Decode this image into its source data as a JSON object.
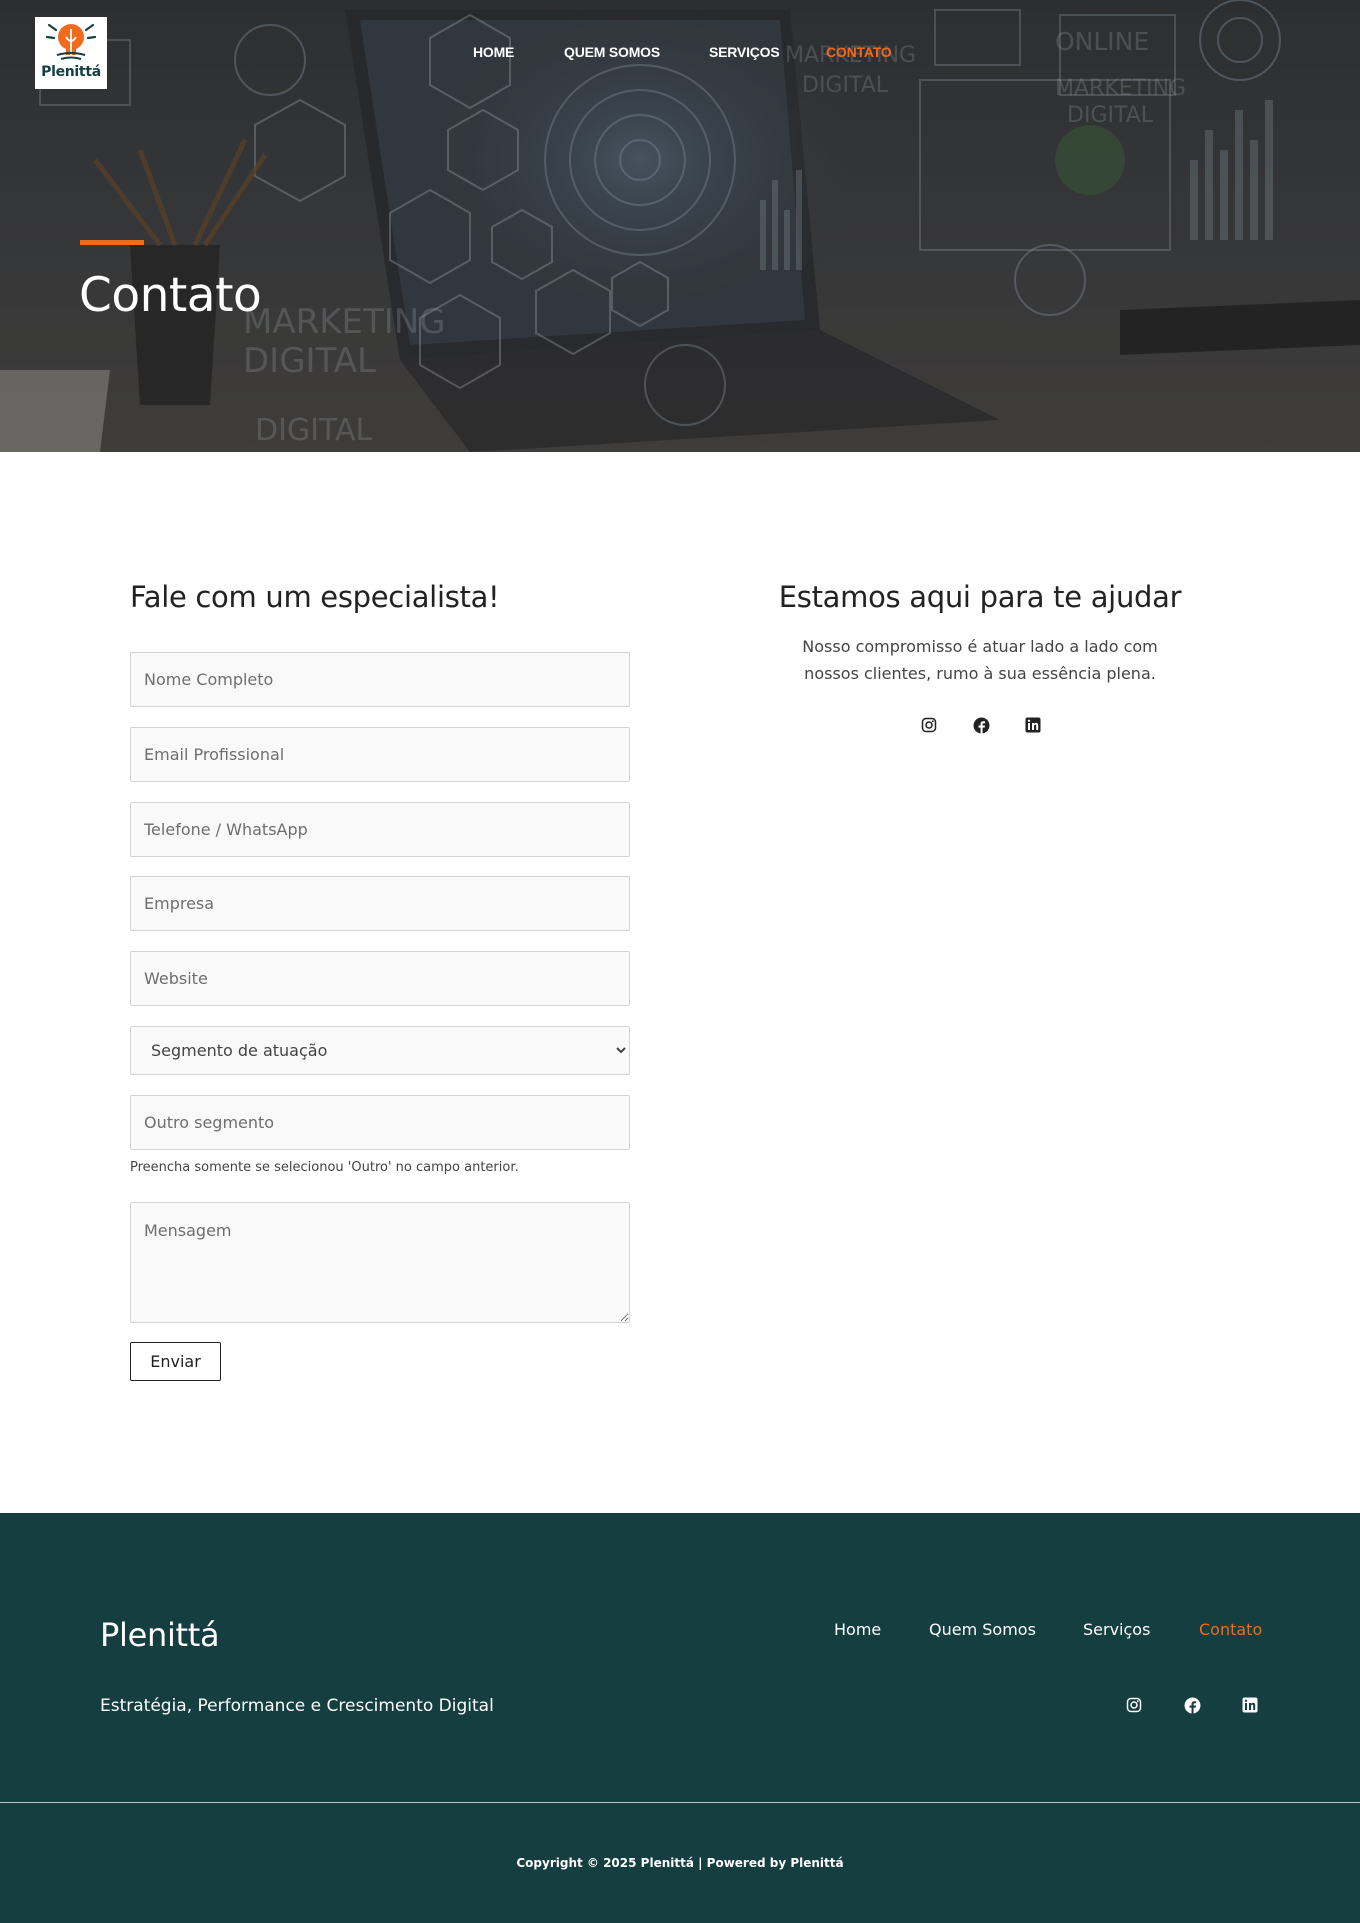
{
  "brand": {
    "logo_text": "Plenittá",
    "accent_color": "#f26a1b",
    "dark_color": "#143e3f"
  },
  "nav": {
    "items": [
      {
        "label": "HOME",
        "active": false
      },
      {
        "label": "QUEM SOMOS",
        "active": false
      },
      {
        "label": "SERVIÇOS",
        "active": false
      },
      {
        "label": "CONTATO",
        "active": true
      }
    ]
  },
  "hero": {
    "title": "Contato",
    "background_words": [
      "MARKETING DIGITAL",
      "ONLINE",
      "MARKETING DIGITAL",
      "MARKETING DIGITAL",
      "DIGITAL"
    ]
  },
  "form": {
    "title": "Fale com um especialista!",
    "fields": {
      "name": {
        "placeholder": "Nome Completo",
        "value": ""
      },
      "email": {
        "placeholder": "Email Profissional",
        "value": ""
      },
      "phone": {
        "placeholder": "Telefone / WhatsApp",
        "value": ""
      },
      "company": {
        "placeholder": "Empresa",
        "value": ""
      },
      "website": {
        "placeholder": "Website",
        "value": ""
      },
      "segment": {
        "selected": "Segmento de atuação"
      },
      "other_segment": {
        "placeholder": "Outro segmento",
        "value": ""
      },
      "message": {
        "placeholder": "Mensagem",
        "value": ""
      }
    },
    "hint": "Preencha somente se selecionou 'Outro' no campo anterior.",
    "submit_label": "Enviar"
  },
  "help": {
    "title": "Estamos aqui para te ajudar",
    "text": "Nosso compromisso é atuar lado a lado com nossos clientes, rumo à sua essência plena.",
    "social_icons": [
      "instagram-icon",
      "facebook-icon",
      "linkedin-icon"
    ]
  },
  "footer": {
    "brand": "Plenittá",
    "tagline": "Estratégia, Performance e Crescimento Digital",
    "nav": [
      {
        "label": "Home",
        "active": false
      },
      {
        "label": "Quem Somos",
        "active": false
      },
      {
        "label": "Serviços",
        "active": false
      },
      {
        "label": "Contato",
        "active": true
      }
    ],
    "social_icons": [
      "instagram-icon",
      "facebook-icon",
      "linkedin-icon"
    ],
    "copyright": "Copyright © 2025 Plenittá | Powered by Plenittá"
  }
}
